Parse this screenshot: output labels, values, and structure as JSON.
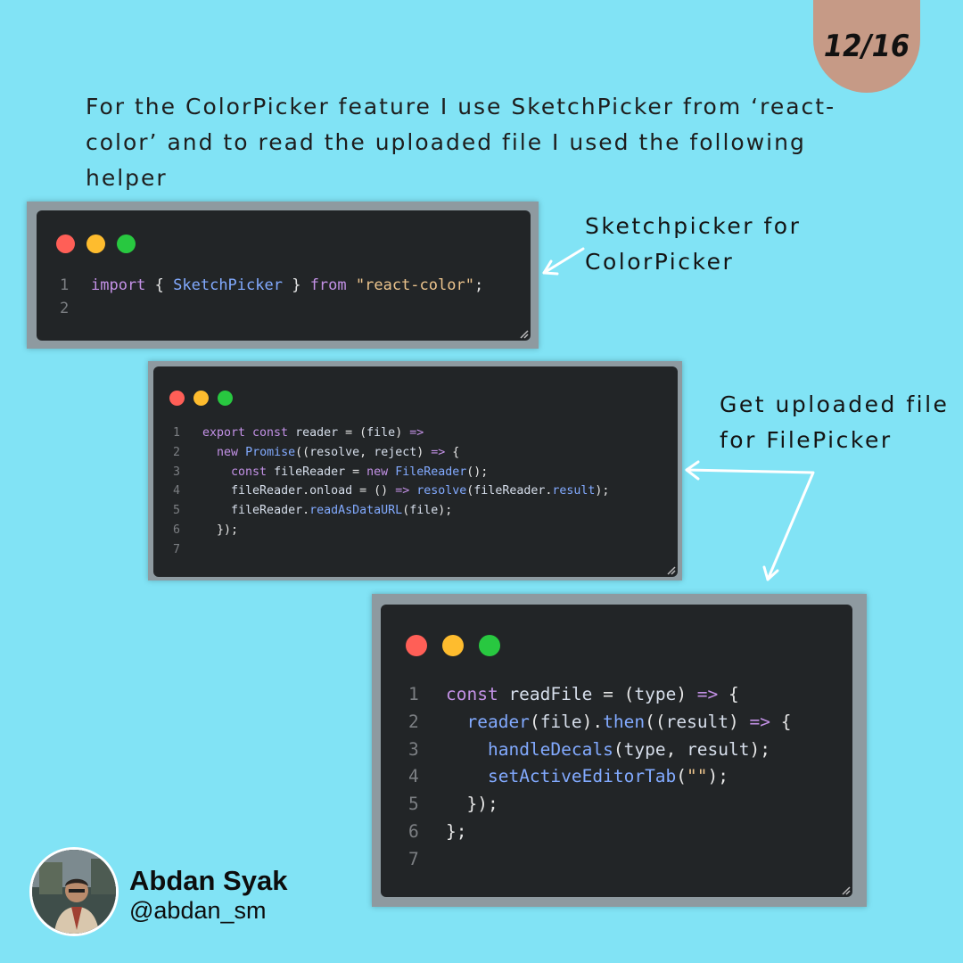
{
  "page_indicator": "12/16",
  "intro_text": "For the ColorPicker feature I use SketchPicker from ‘react-color’ and to read the uploaded file I used the following helper",
  "notes": {
    "sketchpicker": "Sketchpicker  for\nColorPicker",
    "uploaded": "Get uploaded file\nfor FilePicker"
  },
  "snippet1": [
    {
      "num": "1",
      "parts": [
        {
          "t": "import",
          "c": "kw"
        },
        {
          "t": " { ",
          "c": "pn"
        },
        {
          "t": "SketchPicker",
          "c": "fn"
        },
        {
          "t": " } ",
          "c": "pn"
        },
        {
          "t": "from",
          "c": "kw"
        },
        {
          "t": " ",
          "c": "pn"
        },
        {
          "t": "\"react-color\"",
          "c": "str"
        },
        {
          "t": ";",
          "c": "pn"
        }
      ]
    },
    {
      "num": "2",
      "parts": []
    }
  ],
  "snippet2": [
    {
      "num": "1",
      "parts": [
        {
          "t": "export const",
          "c": "kw"
        },
        {
          "t": " reader ",
          "c": "id"
        },
        {
          "t": "= (",
          "c": "pn"
        },
        {
          "t": "file",
          "c": "id"
        },
        {
          "t": ") ",
          "c": "pn"
        },
        {
          "t": "=>",
          "c": "kw"
        }
      ]
    },
    {
      "num": "2",
      "parts": [
        {
          "t": "  ",
          "c": "pn"
        },
        {
          "t": "new",
          "c": "kw"
        },
        {
          "t": " ",
          "c": "pn"
        },
        {
          "t": "Promise",
          "c": "fn"
        },
        {
          "t": "((",
          "c": "pn"
        },
        {
          "t": "resolve",
          "c": "id"
        },
        {
          "t": ", ",
          "c": "pn"
        },
        {
          "t": "reject",
          "c": "id"
        },
        {
          "t": ") ",
          "c": "pn"
        },
        {
          "t": "=>",
          "c": "kw"
        },
        {
          "t": " {",
          "c": "pn"
        }
      ]
    },
    {
      "num": "3",
      "parts": [
        {
          "t": "    ",
          "c": "pn"
        },
        {
          "t": "const",
          "c": "kw"
        },
        {
          "t": " fileReader ",
          "c": "id"
        },
        {
          "t": "= ",
          "c": "pn"
        },
        {
          "t": "new",
          "c": "kw"
        },
        {
          "t": " ",
          "c": "pn"
        },
        {
          "t": "FileReader",
          "c": "fn"
        },
        {
          "t": "();",
          "c": "pn"
        }
      ]
    },
    {
      "num": "4",
      "parts": [
        {
          "t": "    ",
          "c": "pn"
        },
        {
          "t": "fileReader",
          "c": "id"
        },
        {
          "t": ".",
          "c": "pn"
        },
        {
          "t": "onload",
          "c": "id"
        },
        {
          "t": " = () ",
          "c": "pn"
        },
        {
          "t": "=>",
          "c": "kw"
        },
        {
          "t": " ",
          "c": "pn"
        },
        {
          "t": "resolve",
          "c": "fn"
        },
        {
          "t": "(",
          "c": "pn"
        },
        {
          "t": "fileReader",
          "c": "id"
        },
        {
          "t": ".",
          "c": "pn"
        },
        {
          "t": "result",
          "c": "fn"
        },
        {
          "t": ");",
          "c": "pn"
        }
      ]
    },
    {
      "num": "5",
      "parts": [
        {
          "t": "    ",
          "c": "pn"
        },
        {
          "t": "fileReader",
          "c": "id"
        },
        {
          "t": ".",
          "c": "pn"
        },
        {
          "t": "readAsDataURL",
          "c": "fn"
        },
        {
          "t": "(",
          "c": "pn"
        },
        {
          "t": "file",
          "c": "id"
        },
        {
          "t": ");",
          "c": "pn"
        }
      ]
    },
    {
      "num": "6",
      "parts": [
        {
          "t": "  });",
          "c": "pn"
        }
      ]
    },
    {
      "num": "7",
      "parts": []
    }
  ],
  "snippet3": [
    {
      "num": "1",
      "parts": [
        {
          "t": "const",
          "c": "kw"
        },
        {
          "t": " readFile ",
          "c": "id"
        },
        {
          "t": "= (",
          "c": "pn"
        },
        {
          "t": "type",
          "c": "id"
        },
        {
          "t": ") ",
          "c": "pn"
        },
        {
          "t": "=>",
          "c": "kw"
        },
        {
          "t": " {",
          "c": "pn"
        }
      ]
    },
    {
      "num": "2",
      "parts": [
        {
          "t": "  ",
          "c": "pn"
        },
        {
          "t": "reader",
          "c": "fn"
        },
        {
          "t": "(",
          "c": "pn"
        },
        {
          "t": "file",
          "c": "id"
        },
        {
          "t": ").",
          "c": "pn"
        },
        {
          "t": "then",
          "c": "fn"
        },
        {
          "t": "((",
          "c": "pn"
        },
        {
          "t": "result",
          "c": "id"
        },
        {
          "t": ") ",
          "c": "pn"
        },
        {
          "t": "=>",
          "c": "kw"
        },
        {
          "t": " {",
          "c": "pn"
        }
      ]
    },
    {
      "num": "3",
      "parts": [
        {
          "t": "    ",
          "c": "pn"
        },
        {
          "t": "handleDecals",
          "c": "fn"
        },
        {
          "t": "(",
          "c": "pn"
        },
        {
          "t": "type",
          "c": "id"
        },
        {
          "t": ", ",
          "c": "pn"
        },
        {
          "t": "result",
          "c": "id"
        },
        {
          "t": ");",
          "c": "pn"
        }
      ]
    },
    {
      "num": "4",
      "parts": [
        {
          "t": "    ",
          "c": "pn"
        },
        {
          "t": "setActiveEditorTab",
          "c": "fn"
        },
        {
          "t": "(",
          "c": "pn"
        },
        {
          "t": "\"\"",
          "c": "str"
        },
        {
          "t": ");",
          "c": "pn"
        }
      ]
    },
    {
      "num": "5",
      "parts": [
        {
          "t": "  });",
          "c": "pn"
        }
      ]
    },
    {
      "num": "6",
      "parts": [
        {
          "t": "};",
          "c": "pn"
        }
      ]
    },
    {
      "num": "7",
      "parts": []
    }
  ],
  "window_dots": [
    "#ff5f57",
    "#febc2e",
    "#28c840"
  ],
  "author": {
    "name": "Abdan Syak",
    "handle": "@abdan_sm"
  }
}
